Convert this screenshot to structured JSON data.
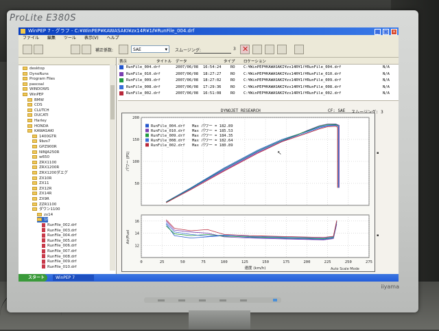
{
  "monitor": {
    "brand": "ProLite E380S",
    "vendor": "iiyama"
  },
  "window": {
    "title": "WinPEP 7 - グラフ - C:¥WinPEP¥KAWASAKI¥zx14R¥1ℓ¥RunFile_004.drf",
    "buttons": [
      "_",
      "□",
      "×"
    ]
  },
  "menu": [
    "ファイル",
    "編集",
    "ツール",
    "表示(V)",
    "ヘルプ"
  ],
  "toolbar": {
    "correction_label": "補正係数:",
    "correction_value": "SAE",
    "smoothing_label": "スムージング:",
    "smoothing_value": "3"
  },
  "sidebar": {
    "items": [
      {
        "label": "desktop",
        "type": "folder",
        "indent": 0
      },
      {
        "label": "DynoRuns",
        "type": "folder",
        "indent": 0
      },
      {
        "label": "Program Files",
        "type": "folder",
        "indent": 0
      },
      {
        "label": "pascoal",
        "type": "folder",
        "indent": 0
      },
      {
        "label": "WINDOWS",
        "type": "folder",
        "indent": 0
      },
      {
        "label": "WinPEP",
        "type": "folder",
        "indent": 0
      },
      {
        "label": "BMW",
        "type": "folder",
        "indent": 1
      },
      {
        "label": "CDS",
        "type": "folder",
        "indent": 1
      },
      {
        "label": "CLUTCH",
        "type": "folder",
        "indent": 1
      },
      {
        "label": "DUCATI",
        "type": "folder",
        "indent": 1
      },
      {
        "label": "Harley",
        "type": "folder",
        "indent": 1
      },
      {
        "label": "HONDA",
        "type": "folder",
        "indent": 1
      },
      {
        "label": "KAWASAKI",
        "type": "folder",
        "indent": 1
      },
      {
        "label": "1400GTR",
        "type": "folder",
        "indent": 2
      },
      {
        "label": "9bzs7",
        "type": "folder",
        "indent": 2
      },
      {
        "label": "GPZ900R",
        "type": "folder",
        "indent": 2
      },
      {
        "label": "NINJA250R",
        "type": "folder",
        "indent": 2
      },
      {
        "label": "w650",
        "type": "folder",
        "indent": 2
      },
      {
        "label": "ZRX1100",
        "type": "folder",
        "indent": 2
      },
      {
        "label": "ZRX1200R",
        "type": "folder",
        "indent": 2
      },
      {
        "label": "ZRX1200ダエグ",
        "type": "folder",
        "indent": 2
      },
      {
        "label": "ZX10R",
        "type": "folder",
        "indent": 2
      },
      {
        "label": "ZX11",
        "type": "folder",
        "indent": 2
      },
      {
        "label": "ZX12R",
        "type": "folder",
        "indent": 2
      },
      {
        "label": "ZX14R",
        "type": "folder",
        "indent": 2
      },
      {
        "label": "ZX9R",
        "type": "folder",
        "indent": 2
      },
      {
        "label": "ZZR1100",
        "type": "folder",
        "indent": 2
      },
      {
        "label": "ダウン1100",
        "type": "folder",
        "indent": 2
      },
      {
        "label": "zx14",
        "type": "folder",
        "indent": 3
      },
      {
        "label": "1ℓ",
        "type": "folder",
        "indent": 3,
        "selected": true
      },
      {
        "label": "RunFile_002.drf",
        "type": "file",
        "indent": 4
      },
      {
        "label": "RunFile_003.drf",
        "type": "file",
        "indent": 4
      },
      {
        "label": "RunFile_004.drf",
        "type": "file",
        "indent": 4
      },
      {
        "label": "RunFile_005.drf",
        "type": "file",
        "indent": 4
      },
      {
        "label": "RunFile_006.drf",
        "type": "file",
        "indent": 4
      },
      {
        "label": "RunFile_007.drf",
        "type": "file",
        "indent": 4
      },
      {
        "label": "RunFile_008.drf",
        "type": "file",
        "indent": 4
      },
      {
        "label": "RunFile_009.drf",
        "type": "file",
        "indent": 4
      },
      {
        "label": "RunFile_010.drf",
        "type": "file",
        "indent": 4
      }
    ]
  },
  "filelist": {
    "headers": [
      "表示",
      "タイトル",
      "データ",
      "タイプ",
      "ロケーション"
    ],
    "rows": [
      {
        "color": "#2255cc",
        "file": "RunFile_004.drf",
        "date": "2007/06/08",
        "time": "16:54:24",
        "type": "RO",
        "path": "C:¥WinPEP¥KAWASAKI¥zx14R¥1ℓ¥RunFile_004.drf",
        "na": "N/A"
      },
      {
        "color": "#7a3fb0",
        "file": "RunFile_010.drf",
        "date": "2007/06/08",
        "time": "18:27:27",
        "type": "RO",
        "path": "C:¥WinPEP¥KAWASAKI¥zx14R¥1ℓ¥RunFile_010.drf",
        "na": "N/A"
      },
      {
        "color": "#1f9a40",
        "file": "RunFile_009.drf",
        "date": "2007/06/08",
        "time": "18:27:02",
        "type": "RO",
        "path": "C:¥WinPEP¥KAWASAKI¥zx14R¥1ℓ¥RunFile_009.drf",
        "na": "N/A"
      },
      {
        "color": "#3a6fd8",
        "file": "RunFile_008.drf",
        "date": "2007/06/08",
        "time": "17:29:36",
        "type": "RO",
        "path": "C:¥WinPEP¥KAWASAKI¥zx14R¥1ℓ¥RunFile_008.drf",
        "na": "N/A"
      },
      {
        "color": "#b8283a",
        "file": "RunFile_002.drf",
        "date": "2007/06/08",
        "time": "16:51:08",
        "type": "RO",
        "path": "C:¥WinPEP¥KAWASAKI¥zx14R¥1ℓ¥RunFile_002.drf",
        "na": "N/A"
      }
    ]
  },
  "chart_header": {
    "title": "DYNOJET RESEARCH",
    "cf": "CF: SAE",
    "smoothing": "スムージング: 3"
  },
  "chart_data": [
    {
      "type": "line",
      "ylabel": "パワー (PS)",
      "ylim": [
        0,
        200
      ],
      "yticks": [
        "200",
        "150",
        "100",
        "50"
      ],
      "xlim": [
        0,
        275
      ],
      "legend": [
        {
          "file": "RunFile_004.drf",
          "label": "Max パワー = 182.89",
          "color": "#2255cc"
        },
        {
          "file": "RunFile_010.drf",
          "label": "Max パワー = 185.53",
          "color": "#7a3fb0"
        },
        {
          "file": "RunFile_009.drf",
          "label": "Max パワー = 184.35",
          "color": "#1f9a40"
        },
        {
          "file": "RunFile_008.drf",
          "label": "Max パワー = 182.64",
          "color": "#3a6fd8"
        },
        {
          "file": "RunFile_002.drf",
          "label": "Max パワー = 180.89",
          "color": "#b8283a"
        }
      ],
      "series": [
        {
          "name": "RunFile_004.drf",
          "color": "#2255cc",
          "x": [
            30,
            60,
            100,
            140,
            170,
            200,
            215,
            225,
            235,
            238,
            238
          ],
          "y": [
            8,
            40,
            85,
            125,
            150,
            168,
            178,
            182,
            183,
            180,
            40
          ]
        },
        {
          "name": "RunFile_010.drf",
          "color": "#7a3fb0",
          "x": [
            30,
            60,
            100,
            140,
            170,
            200,
            215,
            225,
            235,
            239,
            239
          ],
          "y": [
            6,
            38,
            80,
            120,
            145,
            170,
            181,
            185,
            185,
            182,
            40
          ]
        },
        {
          "name": "RunFile_009.drf",
          "color": "#1f9a40",
          "x": [
            30,
            60,
            100,
            140,
            170,
            200,
            215,
            225,
            235,
            238,
            238
          ],
          "y": [
            7,
            39,
            83,
            123,
            148,
            169,
            180,
            184,
            184,
            181,
            40
          ]
        },
        {
          "name": "RunFile_008.drf",
          "color": "#3a6fd8",
          "x": [
            32,
            60,
            100,
            140,
            170,
            200,
            215,
            225,
            235,
            238,
            238
          ],
          "y": [
            8,
            38,
            82,
            122,
            147,
            166,
            176,
            181,
            182,
            180,
            40
          ]
        },
        {
          "name": "RunFile_002.drf",
          "color": "#b8283a",
          "x": [
            30,
            60,
            100,
            140,
            170,
            200,
            215,
            225,
            235,
            237,
            237
          ],
          "y": [
            6,
            36,
            78,
            118,
            145,
            164,
            174,
            179,
            180,
            178,
            40
          ]
        }
      ]
    },
    {
      "type": "line",
      "ylabel": "Air/Fuel",
      "ylim": [
        10,
        17
      ],
      "yticks": [
        "16",
        "14",
        "12"
      ],
      "xlabel": "速度 (km/h)",
      "xlim": [
        0,
        275
      ],
      "xticks": [
        "0",
        "25",
        "50",
        "75",
        "100",
        "125",
        "150",
        "175",
        "200",
        "225",
        "250",
        "275"
      ],
      "series": [
        {
          "name": "RunFile_004.drf",
          "color": "#2255cc",
          "x": [
            30,
            40,
            60,
            80,
            100,
            130,
            160,
            190,
            220,
            232,
            236
          ],
          "y": [
            15.5,
            13.6,
            13.2,
            13.4,
            13.6,
            13.3,
            13.2,
            13.1,
            13.0,
            13.2,
            15.8
          ]
        },
        {
          "name": "RunFile_010.drf",
          "color": "#7a3fb0",
          "x": [
            30,
            40,
            60,
            80,
            100,
            130,
            160,
            190,
            220,
            232,
            236
          ],
          "y": [
            16.0,
            14.5,
            14.2,
            14.0,
            13.4,
            13.2,
            13.1,
            13.0,
            12.9,
            13.1,
            15.5
          ]
        },
        {
          "name": "RunFile_009.drf",
          "color": "#1f9a40",
          "x": [
            30,
            40,
            60,
            80,
            100,
            130,
            160,
            190,
            220,
            232,
            236
          ],
          "y": [
            15.2,
            13.9,
            13.6,
            13.8,
            13.5,
            13.4,
            13.3,
            13.2,
            13.1,
            13.3,
            15.9
          ]
        },
        {
          "name": "RunFile_008.drf",
          "color": "#3a6fd8",
          "x": [
            30,
            40,
            60,
            80,
            100,
            130,
            160,
            190,
            220,
            232,
            236
          ],
          "y": [
            15.7,
            14.2,
            13.8,
            13.5,
            13.7,
            13.5,
            13.4,
            13.3,
            13.2,
            13.4,
            16.0
          ]
        },
        {
          "name": "RunFile_002.drf",
          "color": "#b8283a",
          "x": [
            30,
            40,
            60,
            80,
            100,
            130,
            160,
            190,
            220,
            232,
            236
          ],
          "y": [
            16.2,
            14.8,
            14.4,
            14.6,
            13.8,
            13.6,
            13.5,
            13.4,
            13.3,
            13.5,
            16.1
          ]
        }
      ]
    }
  ],
  "status": {
    "autoscale": "Auto Scale Mode"
  },
  "taskbar": {
    "start": "スタート",
    "task": "WinPEP 7"
  }
}
